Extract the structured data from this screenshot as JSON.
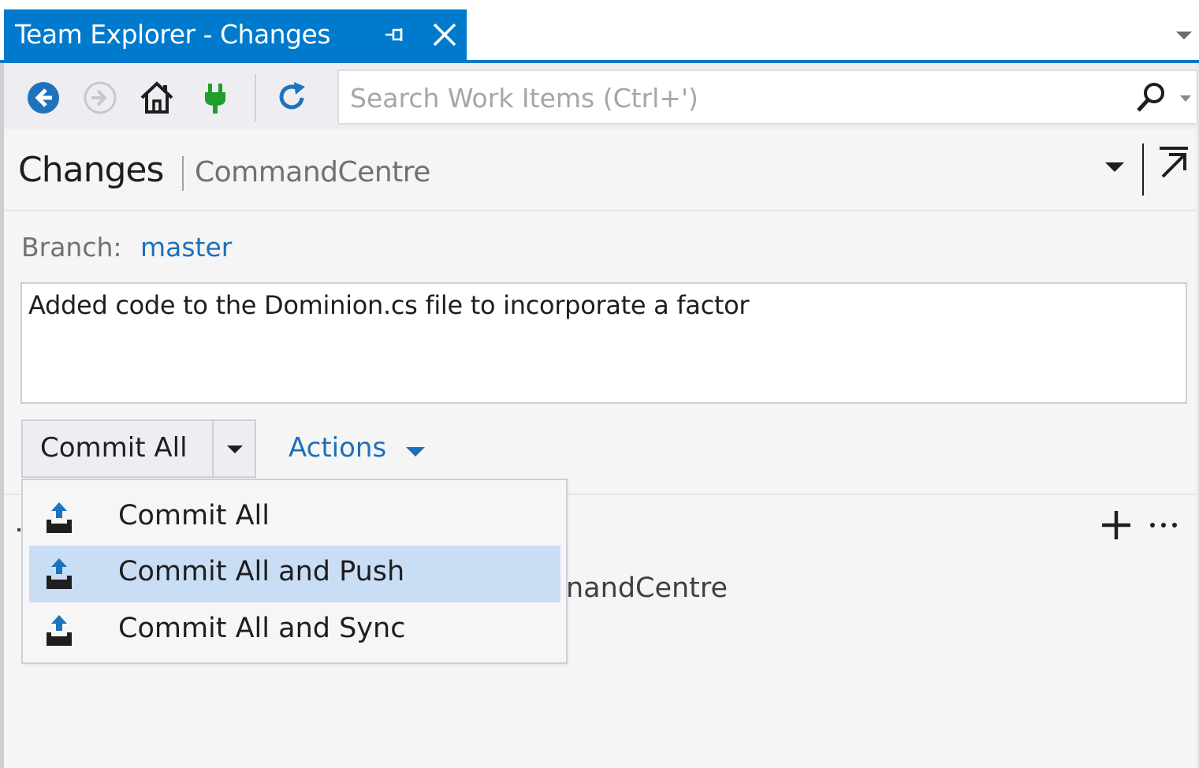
{
  "window": {
    "tab_title": "Team Explorer - Changes"
  },
  "toolbar": {
    "search_placeholder": "Search Work Items (Ctrl+')",
    "accent_color": "#1e73be",
    "connect_icon_color": "#1f9e2e"
  },
  "header": {
    "title": "Changes",
    "subtitle": "CommandCentre"
  },
  "branch": {
    "label": "Branch:",
    "name": "master"
  },
  "commit": {
    "message": "Added code to the Dominion.cs file to incorporate a factor",
    "button_label": "Commit All",
    "actions_label": "Actions"
  },
  "menu": {
    "items": [
      {
        "label": "Commit All",
        "highlighted": false
      },
      {
        "label": "Commit All and Push",
        "highlighted": true
      },
      {
        "label": "Commit All and Sync",
        "highlighted": false
      }
    ]
  },
  "background": {
    "partial_text": "nandCentre"
  },
  "colors": {
    "tab_blue": "#007acc",
    "link_blue": "#1e6fba",
    "menu_highlight": "#c9def5"
  }
}
